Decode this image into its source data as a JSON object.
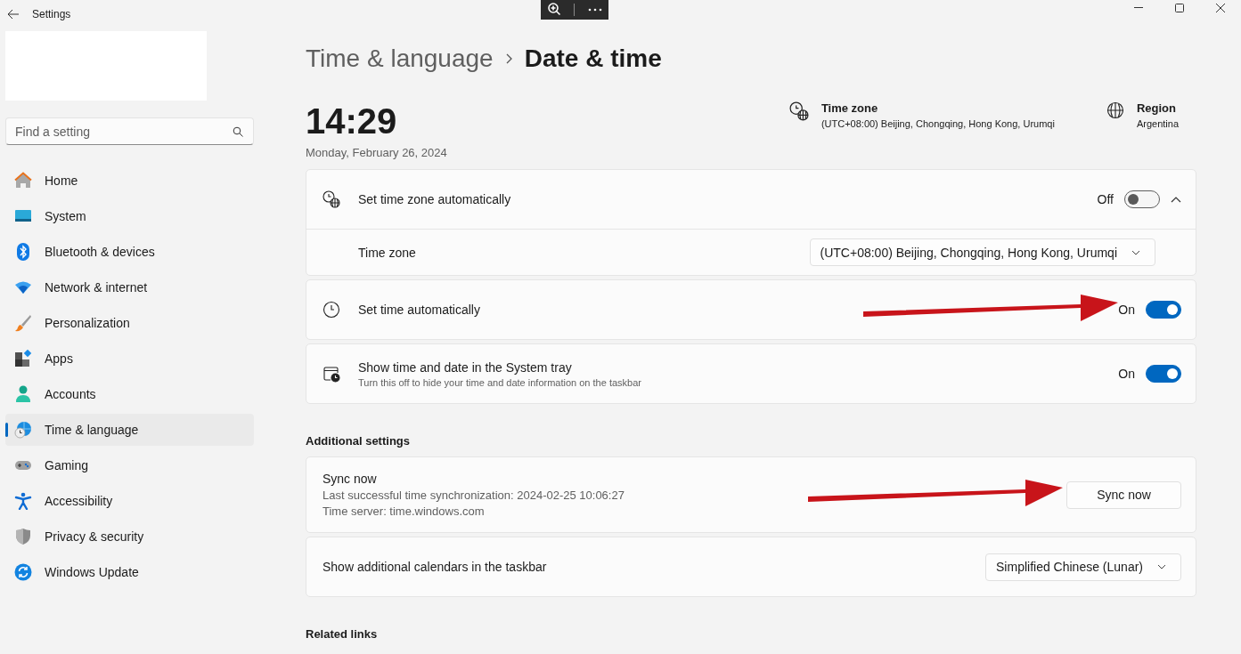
{
  "window": {
    "title": "Settings"
  },
  "search": {
    "placeholder": "Find a setting"
  },
  "sidebar": {
    "items": [
      {
        "label": "Home",
        "kind": "home",
        "selected": false
      },
      {
        "label": "System",
        "kind": "system",
        "selected": false
      },
      {
        "label": "Bluetooth & devices",
        "kind": "bluetooth",
        "selected": false
      },
      {
        "label": "Network & internet",
        "kind": "network",
        "selected": false
      },
      {
        "label": "Personalization",
        "kind": "brush",
        "selected": false
      },
      {
        "label": "Apps",
        "kind": "apps",
        "selected": false
      },
      {
        "label": "Accounts",
        "kind": "accounts",
        "selected": false
      },
      {
        "label": "Time & language",
        "kind": "time",
        "selected": true
      },
      {
        "label": "Gaming",
        "kind": "gaming",
        "selected": false
      },
      {
        "label": "Accessibility",
        "kind": "accessibility",
        "selected": false
      },
      {
        "label": "Privacy & security",
        "kind": "privacy",
        "selected": false
      },
      {
        "label": "Windows Update",
        "kind": "update",
        "selected": false
      }
    ]
  },
  "breadcrumb": {
    "parent": "Time & language",
    "current": "Date & time"
  },
  "clock": {
    "time": "14:29",
    "date": "Monday, February 26, 2024"
  },
  "summary": [
    {
      "kind": "timezone",
      "title": "Time zone",
      "value": "(UTC+08:00) Beijing, Chongqing, Hong Kong, Urumqi"
    },
    {
      "kind": "region",
      "title": "Region",
      "value": "Argentina"
    }
  ],
  "cards": [
    {
      "kind": "toggle",
      "title": "Set time zone automatically",
      "state_label": "Off",
      "on": false,
      "expanded": true,
      "annotated": false,
      "children": [
        {
          "title": "Time zone",
          "value": "(UTC+08:00) Beijing, Chongqing, Hong Kong, Urumqi"
        }
      ]
    },
    {
      "kind": "toggle",
      "title": "Set time automatically",
      "state_label": "On",
      "on": true,
      "annotated": true
    },
    {
      "kind": "toggle",
      "title": "Show time and date in the System tray",
      "subtitle": "Turn this off to hide your time and date information on the taskbar",
      "state_label": "On",
      "on": true,
      "annotated": false
    }
  ],
  "additional": {
    "heading": "Additional settings",
    "cards": [
      {
        "kind": "button",
        "title": "Sync now",
        "lines": [
          "Last successful time synchronization: 2024-02-25 10:06:27",
          "Time server: time.windows.com"
        ],
        "button": "Sync now",
        "annotated": true
      },
      {
        "kind": "dropdown",
        "title": "Show additional calendars in the taskbar",
        "value": "Simplified Chinese (Lunar)"
      }
    ]
  },
  "related": {
    "heading": "Related links"
  }
}
